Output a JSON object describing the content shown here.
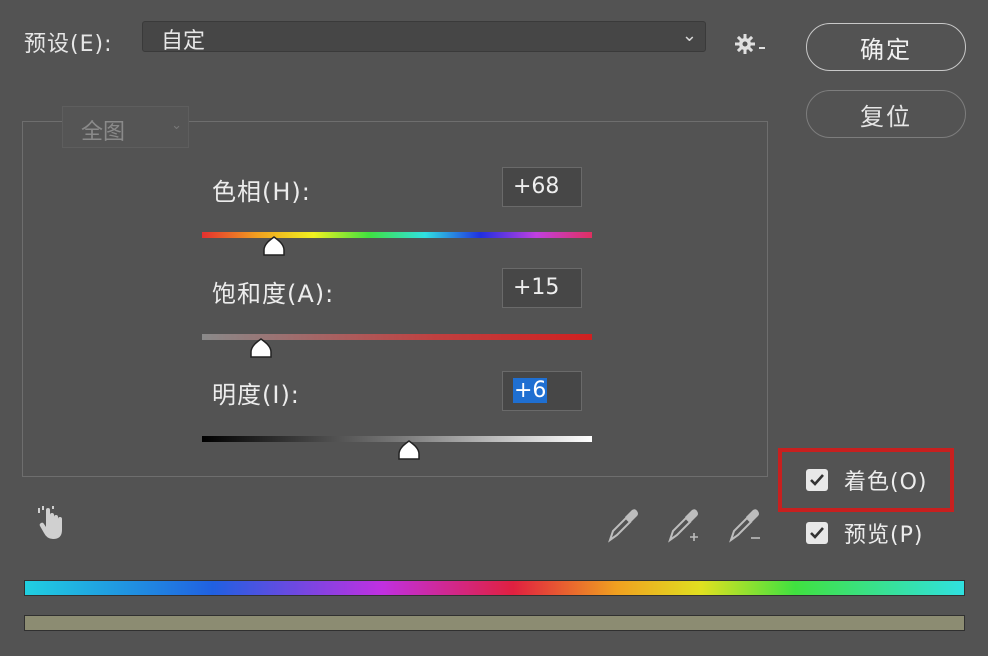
{
  "preset": {
    "label": "预设(E):",
    "value": "自定"
  },
  "buttons": {
    "ok": "确定",
    "reset": "复位"
  },
  "channel": {
    "value": "全图"
  },
  "hue": {
    "label": "色相(H):",
    "value": "+68",
    "fraction": 0.185
  },
  "saturation": {
    "label": "饱和度(A):",
    "value": "+15",
    "fraction": 0.15
  },
  "lightness": {
    "label": "明度(I):",
    "value": "+6",
    "fraction": 0.53
  },
  "checkboxes": {
    "colorize": {
      "label": "着色(O)",
      "checked": true
    },
    "preview": {
      "label": "预览(P)",
      "checked": true
    }
  },
  "colors": {
    "highlight": "#c8201f",
    "selection": "#1f6fd1"
  },
  "icons": [
    "gear-icon",
    "hand-scrubby-icon",
    "eyedropper-icon",
    "eyedropper-add-icon",
    "eyedropper-subtract-icon",
    "checkmark-icon",
    "chevron-down-icon"
  ]
}
